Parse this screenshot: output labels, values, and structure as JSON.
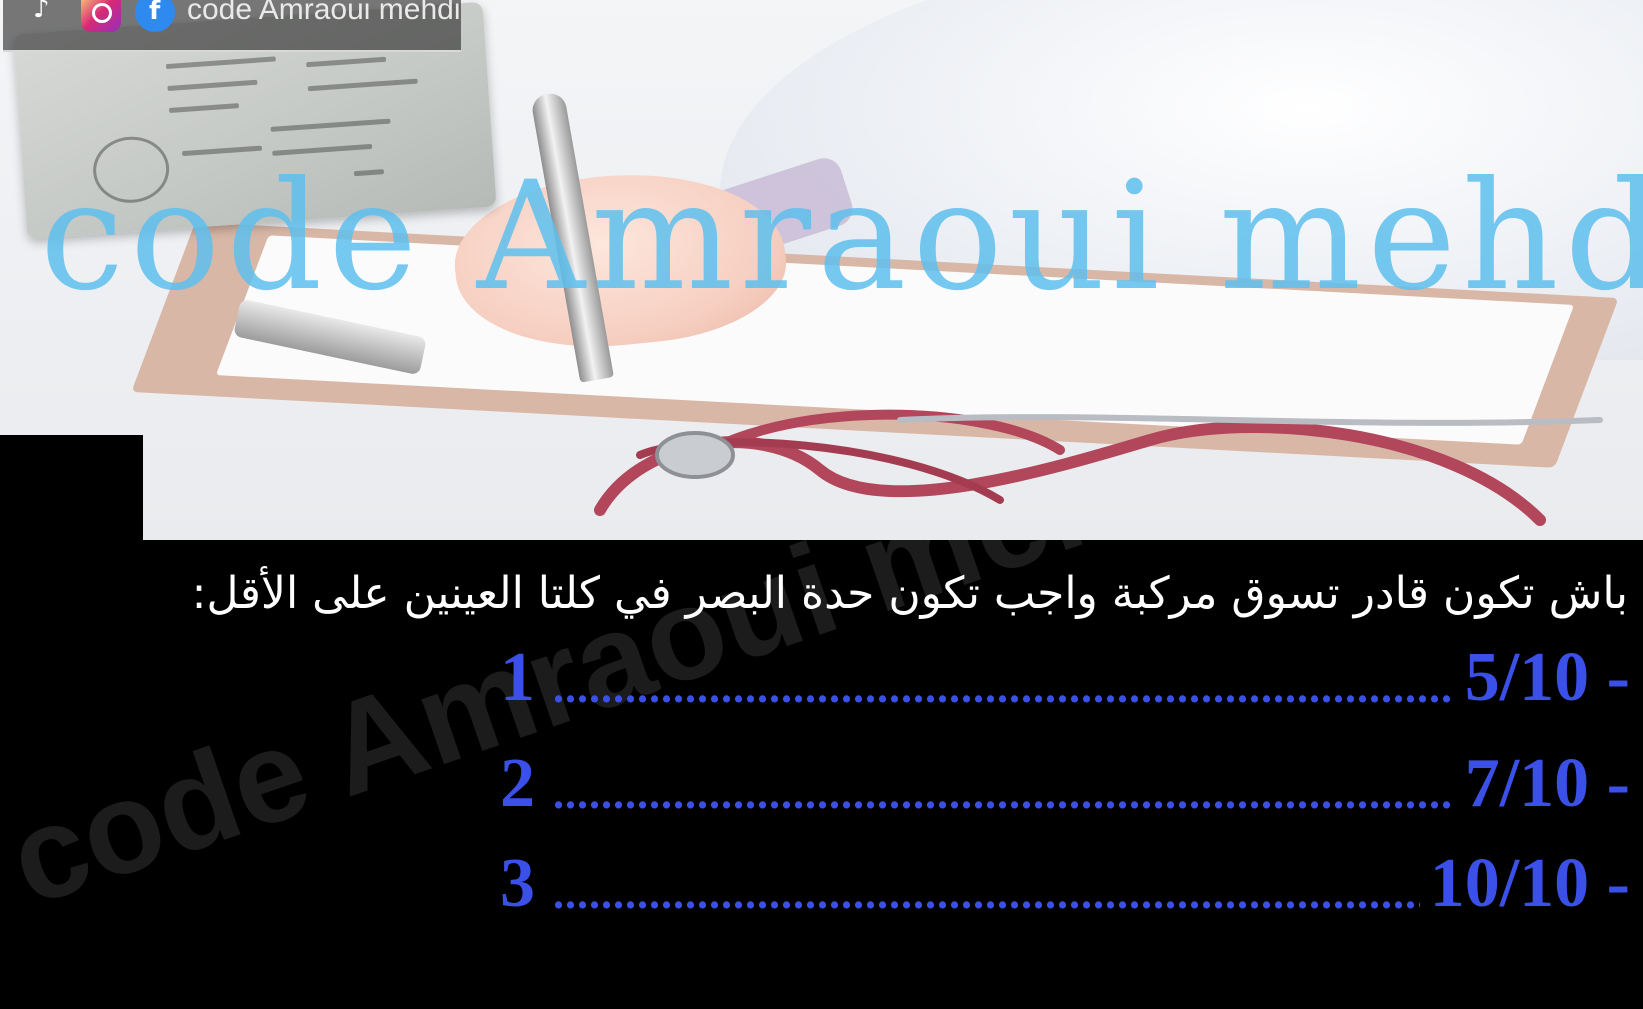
{
  "overlay": {
    "handle": "code Amraoui mehdi",
    "icons": [
      "tiktok-icon",
      "instagram-icon",
      "facebook-icon"
    ]
  },
  "image": {
    "watermark": "code Amraoui mehdi"
  },
  "panel": {
    "watermark": "code Amraoui mehdi",
    "question": "باش تكون قادر تسوق مركبة واجب تكون حدة البصر في كلتا العينين على الأقل:",
    "options": [
      {
        "number": "1",
        "value": "5/10 -"
      },
      {
        "number": "2",
        "value": "7/10 -"
      },
      {
        "number": "3",
        "value": "10/10 -"
      }
    ]
  },
  "colors": {
    "option_text": "#3b50e8",
    "watermark_blue": "#5ec0ee",
    "background": "#000000"
  }
}
